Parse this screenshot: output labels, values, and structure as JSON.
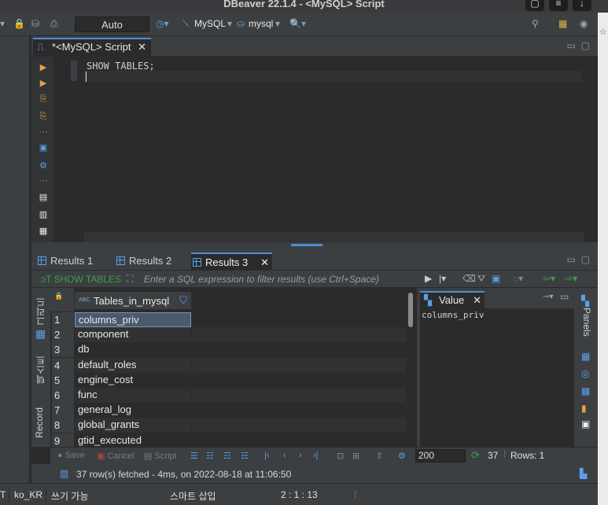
{
  "window": {
    "title": "DBeaver 22.1.4 - <MySQL> Script"
  },
  "toolbar": {
    "mode": "Auto",
    "connection": "MySQL",
    "database": "mysql"
  },
  "editor": {
    "tab_label": "*<MySQL> Script",
    "code_line1": "SHOW TABLES;"
  },
  "results": {
    "tabs": [
      {
        "label": "Results 1"
      },
      {
        "label": "Results 2"
      },
      {
        "label": "Results 3"
      }
    ],
    "query_label": "SHOW TABLES",
    "filter_placeholder": "Enter a SQL expression to filter results (use Ctrl+Space)",
    "side_tabs": {
      "grid": "그리드",
      "text": "텍스트",
      "record": "Record"
    },
    "column_type": "ABC",
    "column_header": "Tables_in_mysql",
    "rows": [
      {
        "n": "1",
        "value": "columns_priv"
      },
      {
        "n": "2",
        "value": "component"
      },
      {
        "n": "3",
        "value": "db"
      },
      {
        "n": "4",
        "value": "default_roles"
      },
      {
        "n": "5",
        "value": "engine_cost"
      },
      {
        "n": "6",
        "value": "func"
      },
      {
        "n": "7",
        "value": "general_log"
      },
      {
        "n": "8",
        "value": "global_grants"
      },
      {
        "n": "9",
        "value": "gtid_executed"
      }
    ],
    "value_panel": {
      "title": "Value",
      "content": "columns_priv"
    },
    "panels_label": "Panels",
    "bottom": {
      "save": "Save",
      "cancel": "Cancel",
      "script": "Script",
      "fetch_size": "200",
      "refresh_count": "37",
      "rows_label": "Rows: 1"
    },
    "status_message": "37 row(s) fetched - 4ms, on 2022-08-18 at 11:06:50"
  },
  "statusbar": {
    "tz": "T",
    "locale": "ko_KR",
    "writable": "쓰기 가능",
    "insert_mode": "스마트 삽입",
    "position": "2 : 1 : 13"
  },
  "colors": {
    "accent": "#4b8fd6",
    "background": "#2b2b2b",
    "panel": "#3c3f41"
  }
}
